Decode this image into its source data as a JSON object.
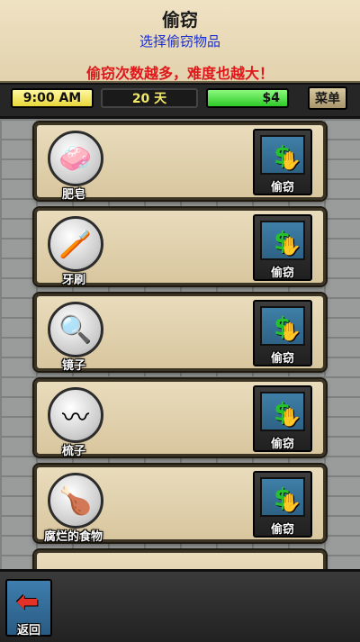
{
  "header": {
    "title": "偷窃",
    "subtitle": "选择偷窃物品",
    "warning": "偷窃次数越多，难度也越大！"
  },
  "status": {
    "time": "9:00 AM",
    "day": "20 天",
    "money": "$4",
    "menu_label": "菜单"
  },
  "items": [
    {
      "name": "肥皂",
      "icon": "soap-icon",
      "glyph": "🧼",
      "action": "偷窃"
    },
    {
      "name": "牙刷",
      "icon": "toothbrush-icon",
      "glyph": "🪥",
      "action": "偷窃"
    },
    {
      "name": "镜子",
      "icon": "mirror-icon",
      "glyph": "🔍",
      "action": "偷窃"
    },
    {
      "name": "梳子",
      "icon": "comb-icon",
      "glyph": "〰",
      "action": "偷窃"
    },
    {
      "name": "腐烂的食物",
      "icon": "rotten-food-icon",
      "glyph": "🍗",
      "action": "偷窃"
    }
  ],
  "footer": {
    "back_label": "返回"
  },
  "colors": {
    "title": "#1a1a1a",
    "subtitle": "#1b2fd0",
    "warning": "#e0161a",
    "money_green": "#2ecb28",
    "time_yellow": "#e8d73a"
  }
}
